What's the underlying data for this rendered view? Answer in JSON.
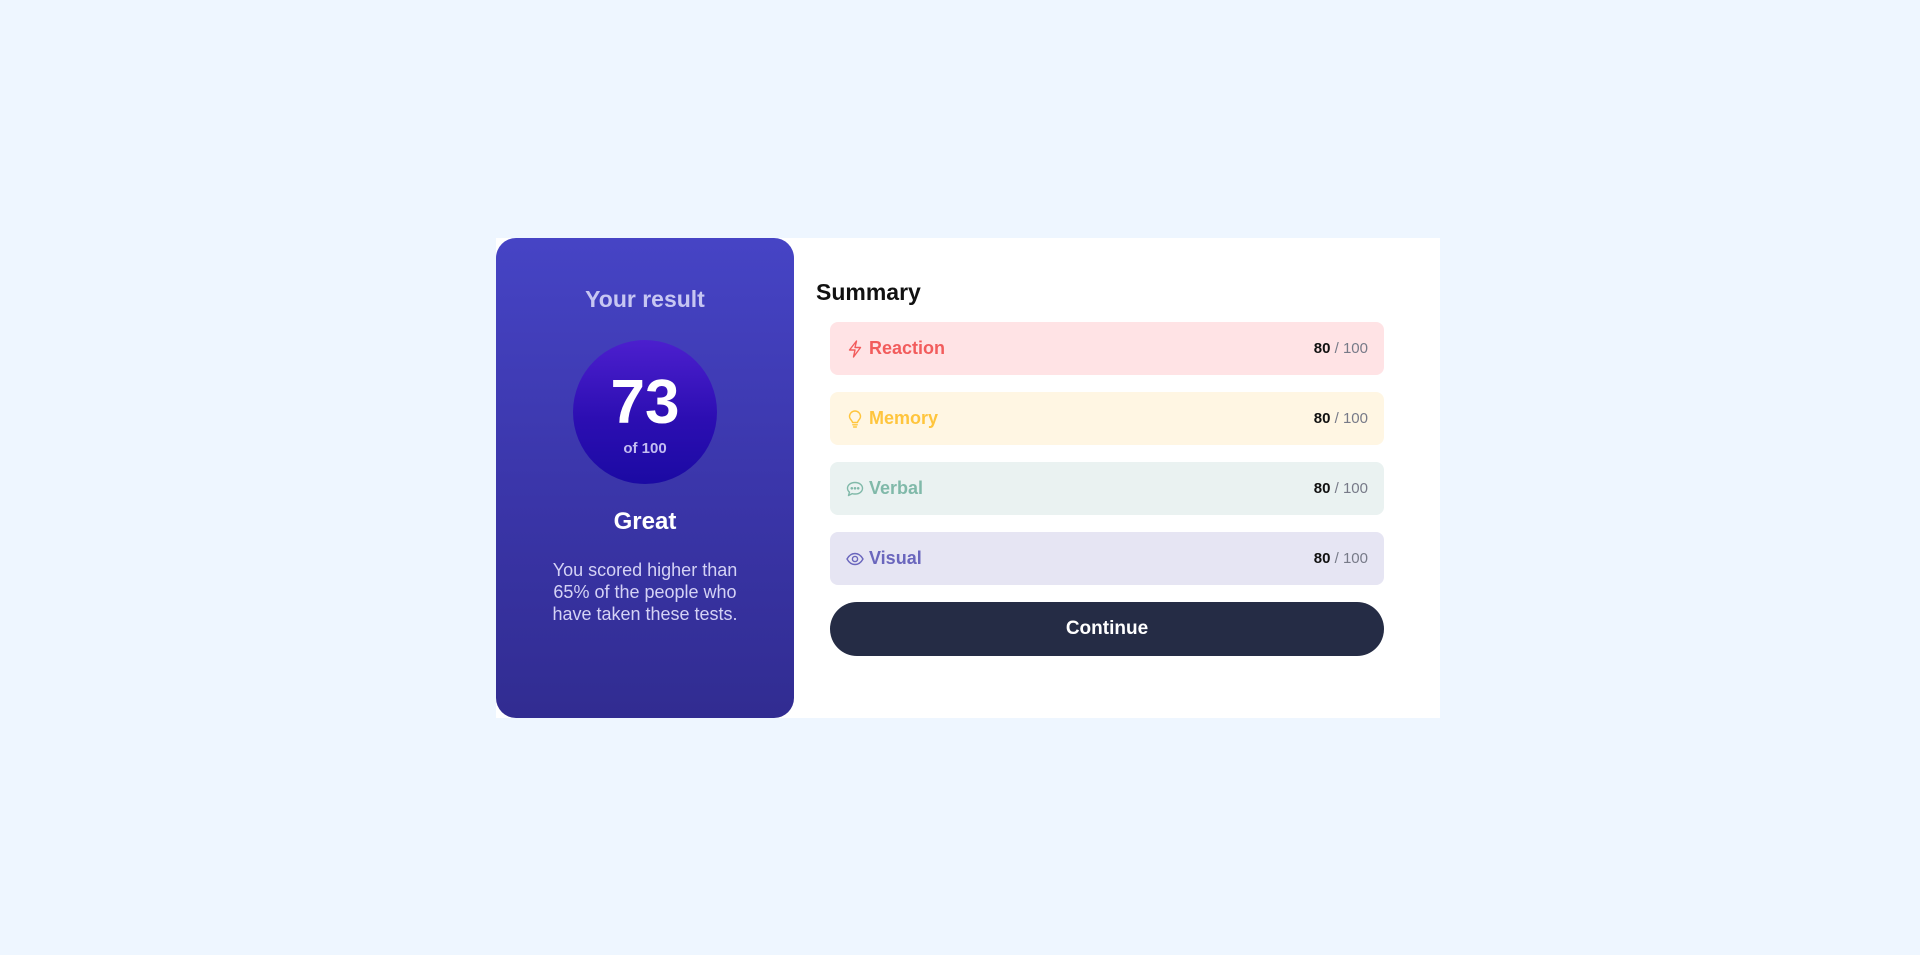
{
  "result": {
    "title": "Your result",
    "score": "73",
    "score_max": "of 100",
    "rating": "Great",
    "description": "You scored higher than 65% of the people who have taken these tests."
  },
  "summary": {
    "title": "Summary",
    "items": [
      {
        "label": "Reaction",
        "score": "80",
        "max": "/ 100",
        "icon": "lightning-icon",
        "color": "#f25c5c",
        "bg": "#ffe3e5"
      },
      {
        "label": "Memory",
        "score": "80",
        "max": "/ 100",
        "icon": "lightbulb-icon",
        "color": "#ffc53d",
        "bg": "#fff6e3"
      },
      {
        "label": "Verbal",
        "score": "80",
        "max": "/ 100",
        "icon": "speech-bubble-icon",
        "color": "#80b9a9",
        "bg": "#eaf2f1"
      },
      {
        "label": "Visual",
        "score": "80",
        "max": "/ 100",
        "icon": "eye-icon",
        "color": "#6a66bd",
        "bg": "#e6e5f3"
      }
    ],
    "continue_label": "Continue"
  },
  "colors": {
    "page_background": "#eef6ff",
    "result_gradient_top": "#4644c5",
    "result_gradient_bottom": "#312c91",
    "button": "#252c45"
  }
}
